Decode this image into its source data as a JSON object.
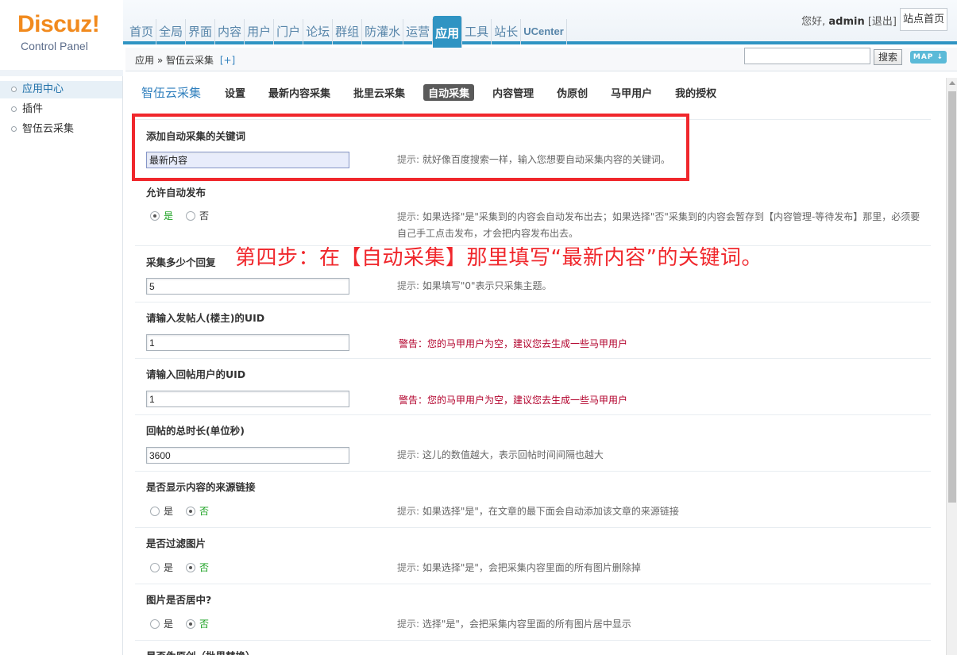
{
  "header": {
    "brand": "Discuz!",
    "brand_sub": "Control Panel",
    "nav": [
      "首页",
      "全局",
      "界面",
      "内容",
      "用户",
      "门户",
      "论坛",
      "群组",
      "防灌水",
      "运营",
      "应用",
      "工具",
      "站长",
      "UCenter"
    ],
    "active_nav": "应用",
    "greeting": "您好,",
    "username": "admin",
    "logout": "[退出]",
    "site_home": "站点首页"
  },
  "subbar": {
    "breadcrumb": "应用 » 智伍云采集",
    "add": "[+]",
    "search_button": "搜索",
    "map_button": "MAP ↓",
    "search_value": ""
  },
  "sidebar": {
    "items": [
      "应用中心",
      "插件",
      "智伍云采集"
    ],
    "active": "应用中心"
  },
  "plugin": {
    "title": "智伍云采集",
    "tabs": [
      "设置",
      "最新内容采集",
      "批里云采集",
      "自动采集",
      "内容管理",
      "伪原创",
      "马甲用户",
      "我的授权"
    ],
    "active_tab": "自动采集"
  },
  "form": {
    "keyword_label": "添加自动采集的关键词",
    "keyword_value": "最新内容",
    "keyword_tip_label": "提示:",
    "keyword_tip": "就好像百度搜索一样，输入您想要自动采集内容的关键词。",
    "autopub_label": "允许自动发布",
    "autopub_yes": "是",
    "autopub_no": "否",
    "autopub_tip_label": "提示:",
    "autopub_tip": "如果选择\"是\"采集到的内容会自动发布出去；如果选择\"否\"采集到的内容会暂存到【内容管理-等待发布】那里，必须要自己手工点击发布，才会把内容发布出去。",
    "replies_label": "采集多少个回复",
    "replies_value": "5",
    "replies_tip_label": "提示:",
    "replies_tip": "如果填写\"0\"表示只采集主题。",
    "poster_uid_label": "请输入发帖人(楼主)的UID",
    "poster_uid_value": "1",
    "poster_warn": "警告：您的马甲用户为空，建议您去生成一些马甲用户",
    "reply_uid_label": "请输入回帖用户的UID",
    "reply_uid_value": "1",
    "reply_warn": "警告：您的马甲用户为空，建议您去生成一些马甲用户",
    "duration_label": "回帖的总时长(单位秒)",
    "duration_value": "3600",
    "duration_tip_label": "提示:",
    "duration_tip": "这儿的数值越大，表示回帖时间间隔也越大",
    "source_label": "是否显示内容的来源链接",
    "source_yes": "是",
    "source_no": "否",
    "source_tip_label": "提示:",
    "source_tip": "如果选择\"是\"，在文章的最下面会自动添加该文章的来源链接",
    "filter_label": "是否过滤图片",
    "filter_yes": "是",
    "filter_no": "否",
    "filter_tip_label": "提示:",
    "filter_tip": "如果选择\"是\"，会把采集内容里面的所有图片删除掉",
    "center_label": "图片是否居中?",
    "center_yes": "是",
    "center_no": "否",
    "center_tip_label": "提示:",
    "center_tip": "选择\"是\"，会把采集内容里面的所有图片居中显示",
    "pseudo_label": "是否伪原创（批里替换）"
  },
  "annotation": "第四步：在【自动采集】那里填写“最新内容”的关键词。",
  "colors": {
    "accent": "#2f94c3",
    "logo": "#f18a1e",
    "annotation_red": "#f0272c",
    "warning": "#b2002b",
    "selected_green": "#1aa120"
  }
}
